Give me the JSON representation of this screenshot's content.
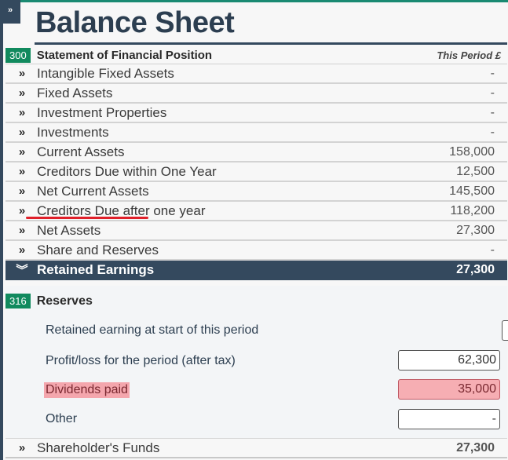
{
  "sidebar_toggle": {
    "icon": "double-chevron-right-icon",
    "glyph": "»"
  },
  "page_title": "Balance Sheet",
  "statement": {
    "code": "300",
    "title": "Statement of Financial Position",
    "column_header": "This Period £"
  },
  "rows": [
    {
      "label": "Intangible Fixed Assets",
      "value": "-",
      "icon": "double-chevron-right-icon",
      "glyph": "»"
    },
    {
      "label": "Fixed Assets",
      "value": "-",
      "icon": "double-chevron-right-icon",
      "glyph": "»"
    },
    {
      "label": "Investment Properties",
      "value": "-",
      "icon": "double-chevron-right-icon",
      "glyph": "»"
    },
    {
      "label": "Investments",
      "value": "-",
      "icon": "double-chevron-right-icon",
      "glyph": "»"
    },
    {
      "label": "Current Assets",
      "value": "158,000",
      "icon": "double-chevron-right-icon",
      "glyph": "»"
    },
    {
      "label": "Creditors Due within One Year",
      "value": "12,500",
      "icon": "double-chevron-right-icon",
      "glyph": "»"
    },
    {
      "label": "Net Current Assets",
      "value": "145,500",
      "icon": "double-chevron-right-icon",
      "glyph": "»"
    },
    {
      "label": "Creditors Due after one year",
      "value": "118,200",
      "icon": "double-chevron-right-icon",
      "glyph": "»"
    },
    {
      "label": "Net Assets",
      "value": "27,300",
      "icon": "double-chevron-right-icon",
      "glyph": "»"
    },
    {
      "label": "Share and Reserves",
      "value": "-",
      "icon": "double-chevron-right-icon",
      "glyph": "»"
    }
  ],
  "active_row": {
    "label": "Retained Earnings",
    "value": "27,300",
    "icon": "double-chevron-down-icon",
    "glyph": "︾"
  },
  "reserves": {
    "code": "316",
    "title": "Reserves",
    "lines": [
      {
        "label": "Retained earning at start of this period",
        "value": ""
      },
      {
        "label": "Profit/loss for the period (after tax)",
        "value": "62,300"
      },
      {
        "label": "Dividends paid",
        "value": "35,000",
        "highlighted": true
      },
      {
        "label": "Other",
        "value": "-"
      }
    ]
  },
  "footer_row": {
    "label": "Shareholder's Funds",
    "value": "27,300",
    "icon": "double-chevron-right-icon",
    "glyph": "»"
  },
  "colors": {
    "accent_green": "#118a5e",
    "header_navy": "#34495e",
    "highlight_pink": "#f6aeb3",
    "annotation_red": "#e0202a",
    "top_border_teal": "#1a8a72"
  }
}
